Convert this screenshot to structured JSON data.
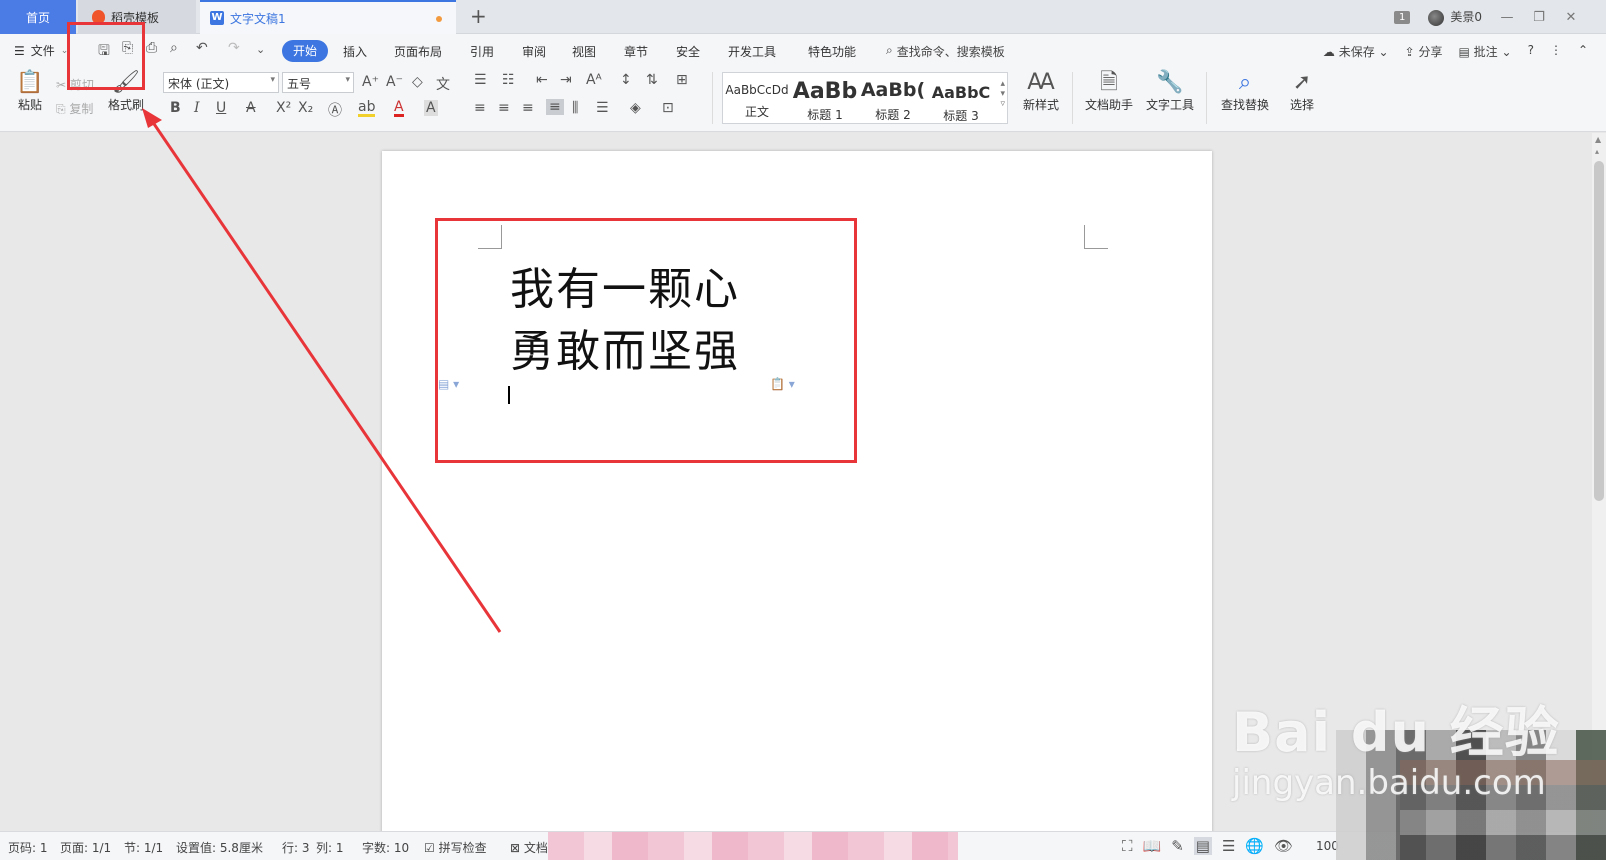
{
  "tabs": {
    "home": "首页",
    "daoke": "稻壳模板",
    "doc": "文字文稿1",
    "add": "+"
  },
  "topright": {
    "window_count": "1",
    "user": "美景0"
  },
  "menu": {
    "file": "文件",
    "items": [
      "开始",
      "插入",
      "页面布局",
      "引用",
      "审阅",
      "视图",
      "章节",
      "安全",
      "开发工具",
      "特色功能"
    ],
    "search": "查找命令、搜索模板",
    "unsaved": "未保存",
    "share": "分享",
    "annotate": "批注"
  },
  "ribbon": {
    "paste": "粘贴",
    "cut": "剪切",
    "copy": "复制",
    "format_painter": "格式刷",
    "font_name": "宋体 (正文)",
    "font_size": "五号",
    "styles": [
      {
        "sample": "AaBbCcDd",
        "label": "正文"
      },
      {
        "sample": "AaBb",
        "label": "标题 1"
      },
      {
        "sample": "AaBb(",
        "label": "标题 2"
      },
      {
        "sample": "AaBbC",
        "label": "标题 3"
      }
    ],
    "new_style": "新样式",
    "doc_helper": "文档助手",
    "text_tools": "文字工具",
    "find_replace": "查找替换",
    "select": "选择"
  },
  "document": {
    "line1": "我有一颗心",
    "line2": "勇敢而坚强"
  },
  "status": {
    "page_no": "页码: 1",
    "pages": "页面: 1/1",
    "section": "节: 1/1",
    "setting": "设置值: 5.8厘米",
    "row": "行: 3",
    "col": "列: 1",
    "words": "字数: 10",
    "spell": "拼写检查",
    "doc_short": "文档",
    "zoom": "100"
  },
  "watermark": {
    "brand": "Bai du 经验",
    "url": "jingyan.baidu.com"
  },
  "colors": {
    "accent": "#3d76e0",
    "annotation": "#e8353a"
  }
}
